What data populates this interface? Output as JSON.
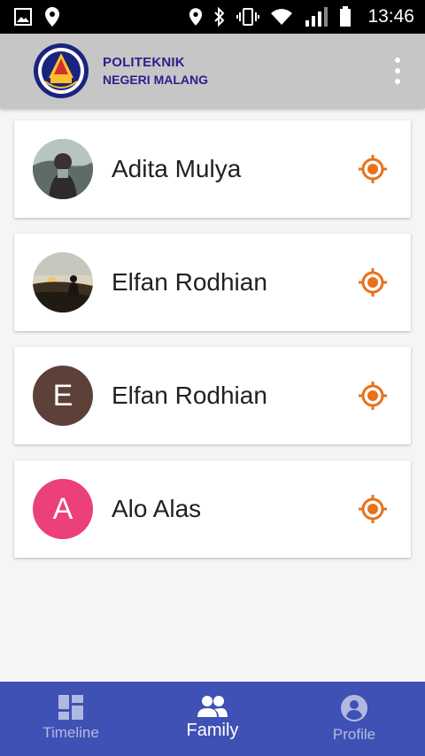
{
  "status_bar": {
    "time": "13:46",
    "icons": [
      "image-icon",
      "location-pin-icon",
      "location-pin-icon",
      "bluetooth-icon",
      "vibrate-icon",
      "wifi-icon",
      "signal-icon",
      "battery-icon"
    ]
  },
  "app_bar": {
    "brand_line1": "POLITEKNIK",
    "brand_line2": "NEGERI MALANG",
    "logo_ring_text": "POLITEKNIK NEGERI MALANG",
    "brand_color": "#2b1f8c",
    "background": "#c6c6c6"
  },
  "members": [
    {
      "name": "Adita Mulya",
      "avatar_type": "photo",
      "avatar_initial": ""
    },
    {
      "name": "Elfan Rodhian",
      "avatar_type": "photo",
      "avatar_initial": ""
    },
    {
      "name": "Elfan Rodhian",
      "avatar_type": "initial",
      "avatar_initial": "E",
      "avatar_color": "#5d4037"
    },
    {
      "name": "Alo Alas",
      "avatar_type": "initial",
      "avatar_initial": "A",
      "avatar_color": "#ec407a"
    }
  ],
  "location_icon_color": "#e8711a",
  "bottom_nav": {
    "items": [
      {
        "label": "Timeline",
        "icon": "dashboard-icon",
        "active": false
      },
      {
        "label": "Family",
        "icon": "people-icon",
        "active": true
      },
      {
        "label": "Profile",
        "icon": "account-circle-icon",
        "active": false
      }
    ],
    "background": "#3f51b5"
  }
}
